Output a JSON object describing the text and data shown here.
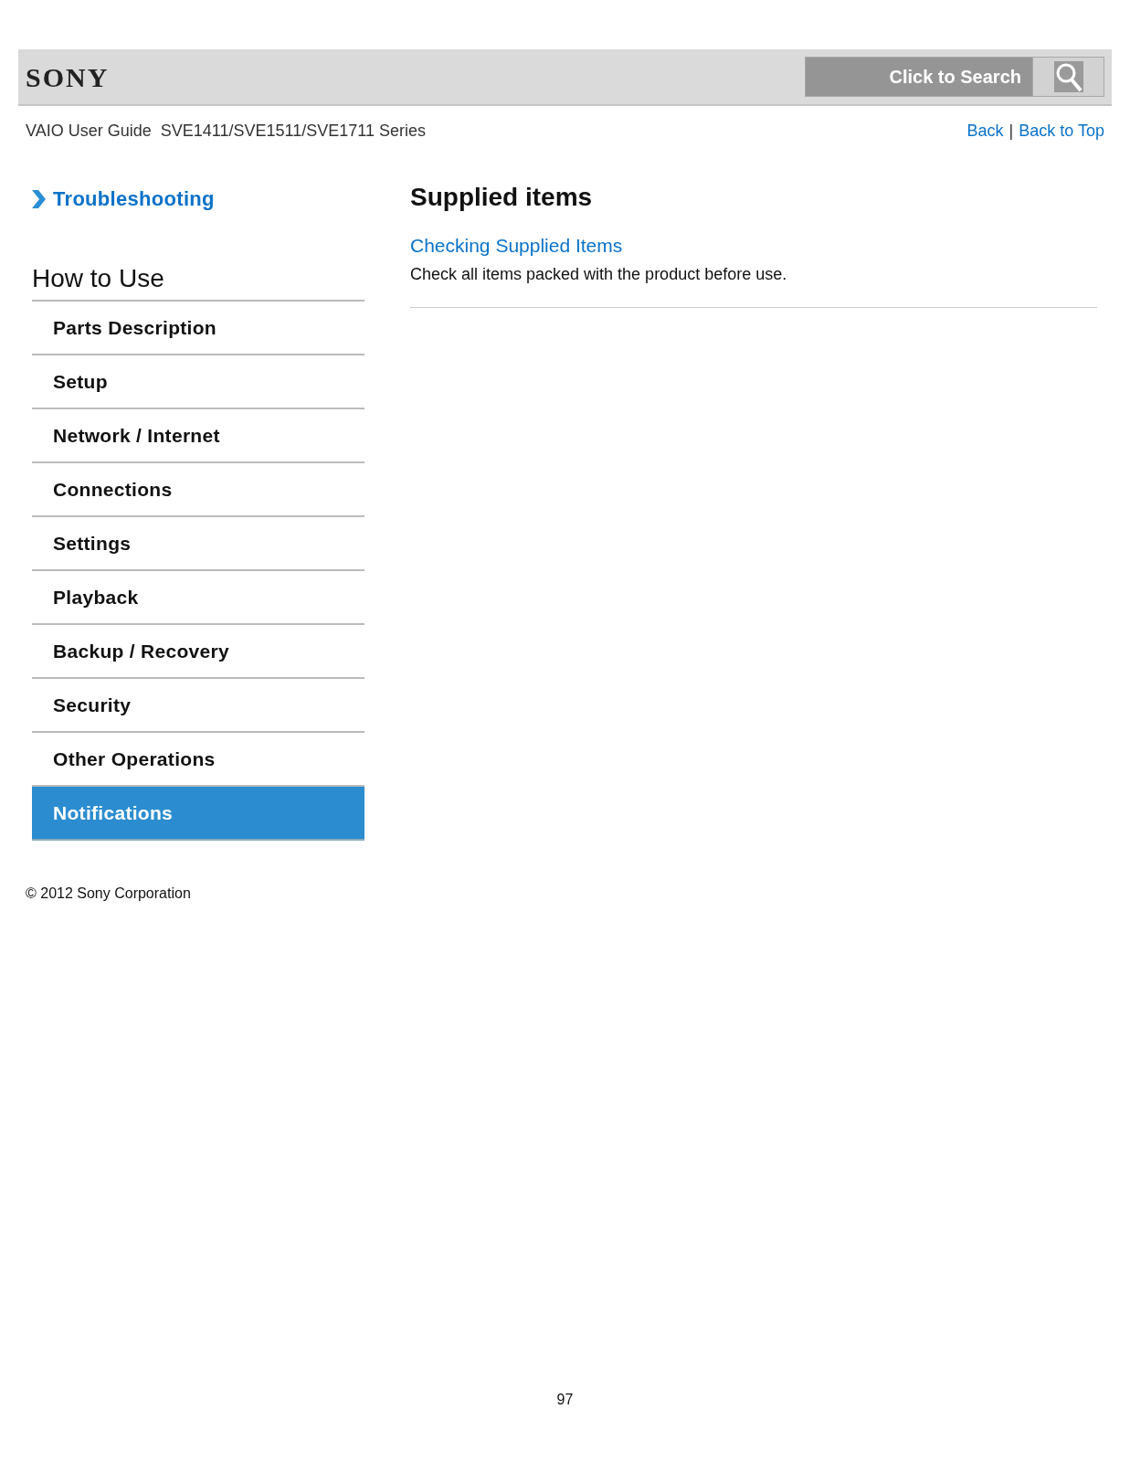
{
  "header": {
    "logo": "SONY",
    "search_placeholder": "Click to Search"
  },
  "subheader": {
    "title": "VAIO User Guide  SVE1411/SVE1511/SVE1711 Series",
    "links": [
      "Back",
      "Back to Top"
    ],
    "separator": "|"
  },
  "sidebar": {
    "top_link": "Troubleshooting",
    "section_title": "How to Use",
    "items": [
      {
        "label": "Parts Description",
        "selected": false
      },
      {
        "label": "Setup",
        "selected": false
      },
      {
        "label": "Network / Internet",
        "selected": false
      },
      {
        "label": "Connections",
        "selected": false
      },
      {
        "label": "Settings",
        "selected": false
      },
      {
        "label": "Playback",
        "selected": false
      },
      {
        "label": "Backup / Recovery",
        "selected": false
      },
      {
        "label": "Security",
        "selected": false
      },
      {
        "label": "Other Operations",
        "selected": false
      },
      {
        "label": "Notifications",
        "selected": true
      }
    ]
  },
  "content": {
    "title": "Supplied items",
    "link": "Checking Supplied Items",
    "description": "Check all items packed with the product before use."
  },
  "footer": {
    "copyright": "© 2012 Sony Corporation"
  },
  "page_number": "97"
}
